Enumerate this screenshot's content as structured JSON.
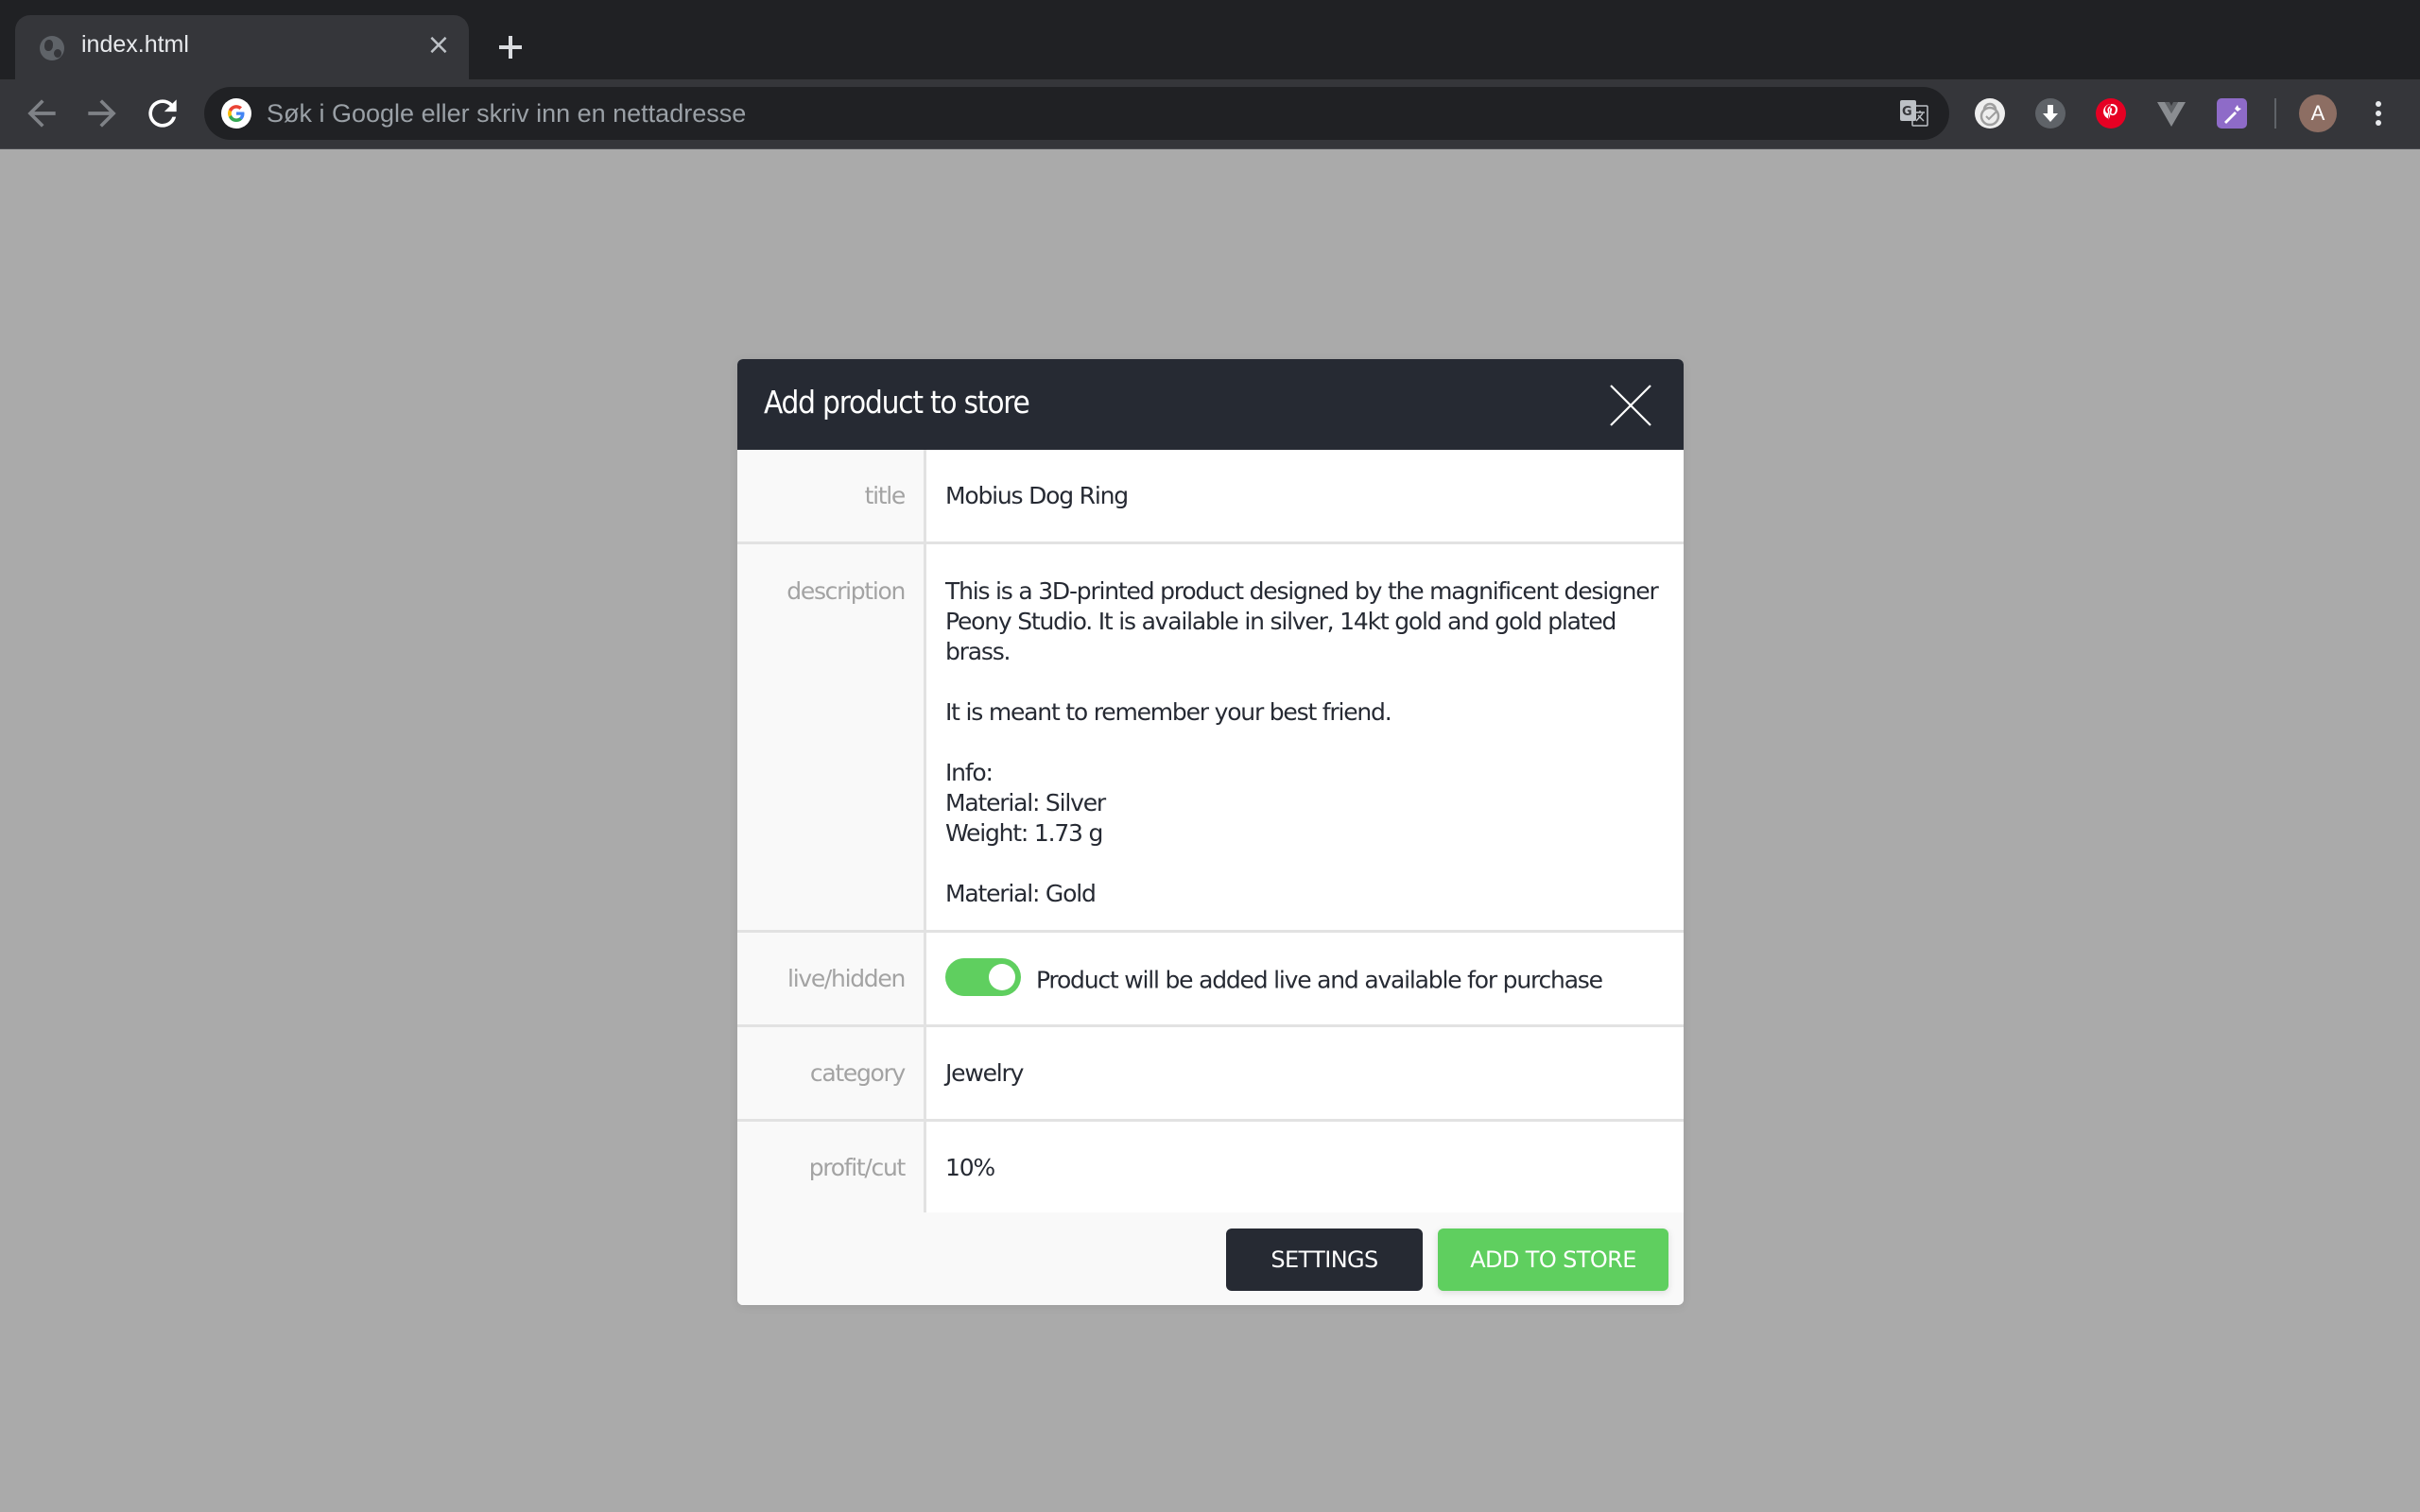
{
  "browser": {
    "tab": {
      "title": "index.html",
      "close_symbol": "×"
    },
    "omnibox": {
      "placeholder": "Søk i Google eller skriv inn en nettadresse",
      "value": ""
    },
    "profile": {
      "initial": "A",
      "color": "#8d6e63"
    },
    "extensions": [
      "translate-icon",
      "cryptonator-lock-icon",
      "downloader-icon",
      "pinterest-icon",
      "vue-devtools-icon",
      "carrot-icon"
    ]
  },
  "modal": {
    "title": "Add product to store",
    "fields": {
      "title": {
        "label": "title",
        "value": "Mobius Dog Ring"
      },
      "description": {
        "label": "description",
        "value": "This is a 3D-printed product designed by the magnificent designer Peony Studio. It is available in silver, 14kt gold and gold plated brass.\n\nIt is meant to remember your best friend.\n\nInfo:\nMaterial: Silver\nWeight: 1.73 g\n\nMaterial: Gold"
      },
      "live": {
        "label": "live/hidden",
        "enabled": true,
        "text": "Product will be added live and available for purchase"
      },
      "category": {
        "label": "category",
        "value": "Jewelry"
      },
      "profit": {
        "label": "profit/cut",
        "value": "10%"
      }
    },
    "buttons": {
      "settings": "SETTINGS",
      "add": "ADD TO STORE"
    }
  },
  "colors": {
    "header": "#262a33",
    "accent_green": "#5fcf5f",
    "backdrop": "#aaaaaa"
  }
}
